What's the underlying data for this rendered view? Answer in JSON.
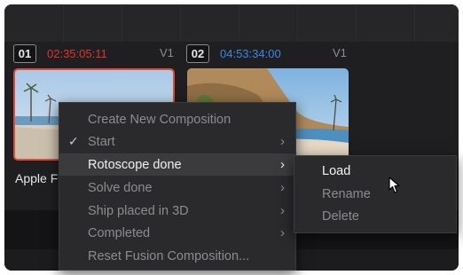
{
  "clips": [
    {
      "number": "01",
      "timecode": "02:35:05:11",
      "track": "V1",
      "name": "Apple F"
    },
    {
      "number": "02",
      "timecode": "04:53:34:00",
      "track": "V1"
    }
  ],
  "colors": {
    "timecode_1": "#e0352b",
    "timecode_2": "#3a86e6",
    "selected_border": "#e04a3a"
  },
  "context_menu": {
    "items": [
      {
        "label": "Create New Composition",
        "check": "",
        "submenu": ""
      },
      {
        "label": "Start",
        "check": "✓",
        "submenu": "›"
      },
      {
        "label": "Rotoscope done",
        "check": "",
        "submenu": "›"
      },
      {
        "label": "Solve done",
        "check": "",
        "submenu": "›"
      },
      {
        "label": "Ship placed in 3D",
        "check": "",
        "submenu": "›"
      },
      {
        "label": "Completed",
        "check": "",
        "submenu": "›"
      },
      {
        "label": "Reset Fusion Composition...",
        "check": "",
        "submenu": ""
      }
    ],
    "highlighted": "Rotoscope done"
  },
  "submenu": {
    "items": [
      {
        "label": "Load"
      },
      {
        "label": "Rename"
      },
      {
        "label": "Delete"
      }
    ]
  },
  "icons": {
    "cursor": "mouse-pointer-icon",
    "checkmark": "checkmark-icon",
    "submenu_arrow": "chevron-right-icon"
  }
}
